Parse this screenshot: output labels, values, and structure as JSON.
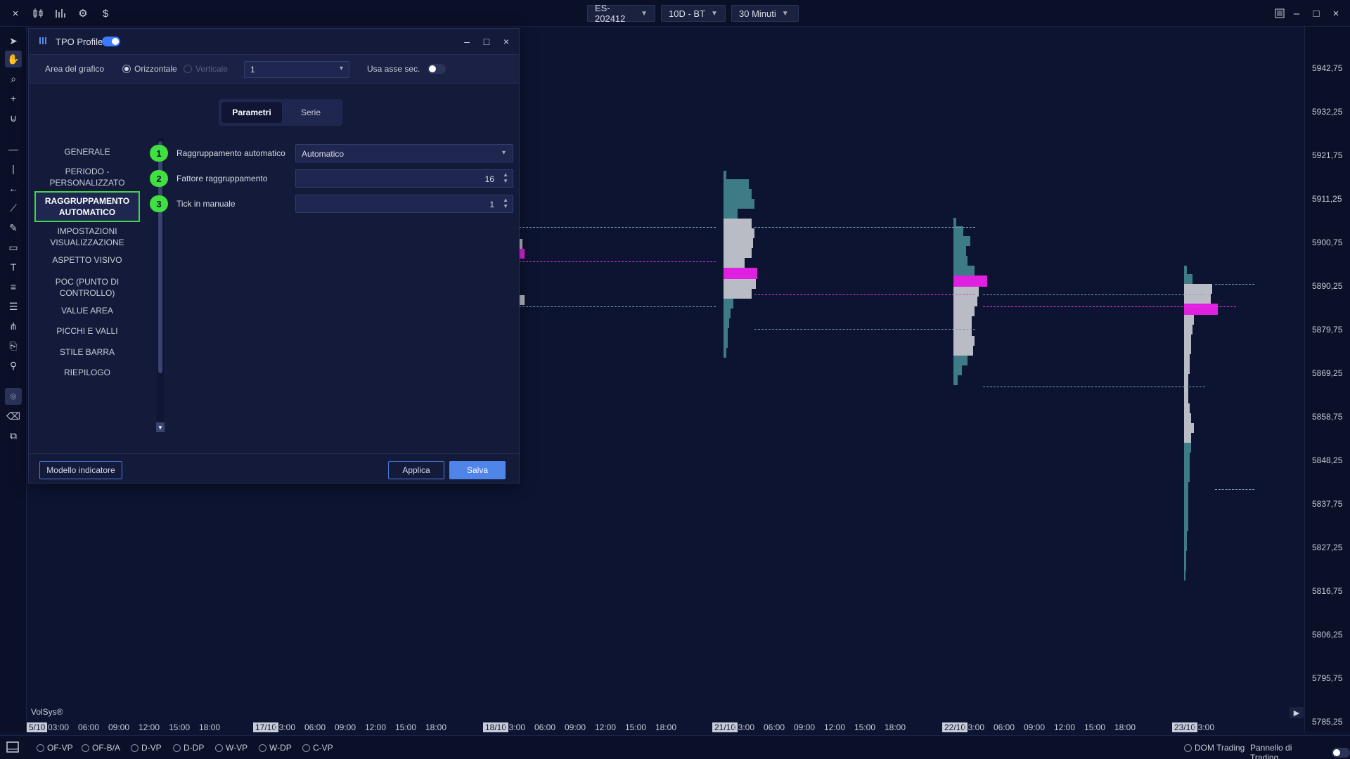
{
  "topbar": {
    "close_icon": "×",
    "symbol": "ES-202412",
    "template": "10D - BT",
    "timeframe": "30 Minuti"
  },
  "dialog": {
    "title": "TPO Profile",
    "area_label": "Area del grafico",
    "orient_h": "Orizzontale",
    "orient_v": "Verticale",
    "area_value": "1",
    "secondary_axis_label": "Usa asse sec.",
    "tabs": [
      "Parametri",
      "Serie"
    ],
    "sidebar": [
      "GENERALE",
      "PERIODO - PERSONALIZZATO",
      "RAGGRUPPAMENTO AUTOMATICO",
      "IMPOSTAZIONI VISUALIZZAZIONE",
      "ASPETTO VISIVO",
      "POC (PUNTO DI CONTROLLO)",
      "VALUE AREA",
      "PICCHI E VALLI",
      "STILE BARRA",
      "RIEPILOGO"
    ],
    "params": [
      {
        "num": "1",
        "label": "Raggruppamento automatico",
        "value": "Automatico"
      },
      {
        "num": "2",
        "label": "Fattore raggruppamento",
        "value": "16"
      },
      {
        "num": "3",
        "label": "Tick in manuale",
        "value": "1"
      }
    ],
    "footer": {
      "template_btn": "Modello indicatore",
      "apply_btn": "Applica",
      "save_btn": "Salva"
    }
  },
  "price_axis": [
    "5942,75",
    "5932,25",
    "5921,75",
    "5911,25",
    "5900,75",
    "5890,25",
    "5879,75",
    "5869,25",
    "5858,75",
    "5848,25",
    "5837,75",
    "5827,25",
    "5816,75",
    "5806,25",
    "5795,75",
    "5785,25"
  ],
  "time_axis": [
    {
      "t": "5/10",
      "date": true
    },
    {
      "t": "03:00"
    },
    {
      "t": "06:00"
    },
    {
      "t": "09:00"
    },
    {
      "t": "12:00"
    },
    {
      "t": "15:00"
    },
    {
      "t": "18:00"
    },
    {
      "t": "17/10",
      "date": true
    },
    {
      "t": "03:00"
    },
    {
      "t": "06:00"
    },
    {
      "t": "09:00"
    },
    {
      "t": "12:00"
    },
    {
      "t": "15:00"
    },
    {
      "t": "18:00"
    },
    {
      "t": "18/10",
      "date": true
    },
    {
      "t": "03:00"
    },
    {
      "t": "06:00"
    },
    {
      "t": "09:00"
    },
    {
      "t": "12:00"
    },
    {
      "t": "15:00"
    },
    {
      "t": "18:00"
    },
    {
      "t": "21/10",
      "date": true
    },
    {
      "t": "03:00"
    },
    {
      "t": "06:00"
    },
    {
      "t": "09:00"
    },
    {
      "t": "12:00"
    },
    {
      "t": "15:00"
    },
    {
      "t": "18:00"
    },
    {
      "t": "22/10",
      "date": true
    },
    {
      "t": "03:00"
    },
    {
      "t": "06:00"
    },
    {
      "t": "09:00"
    },
    {
      "t": "12:00"
    },
    {
      "t": "15:00"
    },
    {
      "t": "18:00"
    },
    {
      "t": "23/10",
      "date": true
    },
    {
      "t": "03:00"
    }
  ],
  "watermark": "VolSys®",
  "bottombar": {
    "items": [
      "OF-VP",
      "OF-B/A",
      "D-VP",
      "D-DP",
      "W-VP",
      "W-DP",
      "C-VP"
    ],
    "dom": "DOM Trading",
    "panel": "Pannello di Trading"
  },
  "colors": {
    "background": "#0d1431",
    "accent": "#4f84e8",
    "highlight": "#3fe03f",
    "poc": "#e020e0",
    "profile_teal": "#3d7b86",
    "profile_gray": "#b9bcc5"
  }
}
